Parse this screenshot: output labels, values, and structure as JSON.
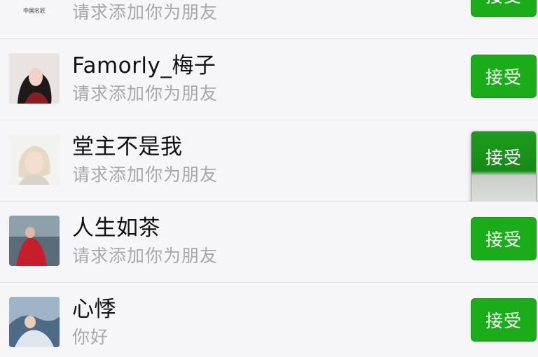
{
  "requests": [
    {
      "name": "",
      "message": "请求添加你为朋友",
      "button": "接受",
      "avatar": "logo",
      "logo_text": "中国名匠"
    },
    {
      "name": "Famorly_梅子",
      "message": "请求添加你为朋友",
      "button": "接受",
      "avatar": "woman-dark"
    },
    {
      "name": "堂主不是我",
      "message": "请求添加你为朋友",
      "button": "接受",
      "avatar": "woman-light",
      "pressed": true
    },
    {
      "name": "人生如茶",
      "message": "请求添加你为朋友",
      "button": "接受",
      "avatar": "red-dress"
    },
    {
      "name": "心悸",
      "message": "你好",
      "button": "接受",
      "avatar": "blue-scene"
    }
  ],
  "colors": {
    "accept_button": "#1aad19",
    "subtext": "#a8a8ab",
    "background": "#f6f6f8"
  }
}
